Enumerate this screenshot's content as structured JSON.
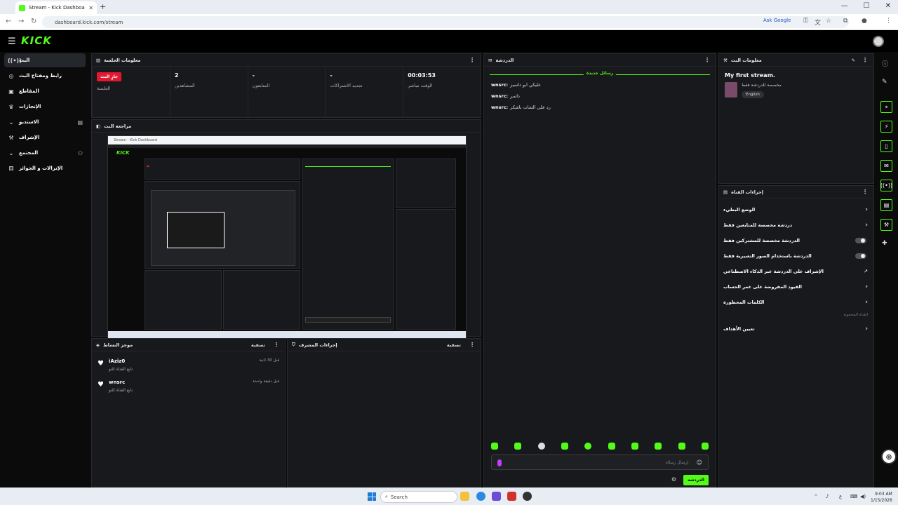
{
  "browser": {
    "tab_title": "Stream - Kick Dashboard",
    "url": "dashboard.kick.com/stream",
    "ask_google": "Ask Google"
  },
  "app": {
    "logo": "KICK"
  },
  "sidebar": {
    "items": [
      {
        "label": "البث",
        "icon": "broadcast-icon"
      },
      {
        "label": "رابط ومفتاح البث",
        "icon": "key-icon"
      },
      {
        "label": "المقاطع",
        "icon": "clips-icon"
      },
      {
        "label": "الإنجازات",
        "icon": "trophy-icon"
      },
      {
        "label": "الاستديو",
        "icon": "studio-icon"
      },
      {
        "label": "الإشراف",
        "icon": "mod-icon"
      },
      {
        "label": "المجتمع",
        "icon": "community-icon"
      },
      {
        "label": "الإنزالات و الجوائز",
        "icon": "drops-icon"
      }
    ]
  },
  "session": {
    "title": "معلومات الجلسة",
    "cells": [
      {
        "value": "00:03:53",
        "label": "الوقت مباشر"
      },
      {
        "value": "-",
        "label": "تجديد الاشتراكات"
      },
      {
        "value": "-",
        "label": "المتابعون"
      },
      {
        "value": "2",
        "label": "المشاهدين"
      },
      {
        "value": "جارٍ البث",
        "label": "الجلسة",
        "badge": true
      }
    ]
  },
  "preview": {
    "title": "مراجعة البث",
    "mini_title": "Stream - Kick Dashboard"
  },
  "activity": {
    "title": "موجز النشاط",
    "filter": "تصفية",
    "items": [
      {
        "name": "iAziz0",
        "sub": "تابع القناة للتو",
        "time": "قبل 30 ثانية"
      },
      {
        "name": "wnsrc",
        "sub": "تابع القناة للتو",
        "time": "قبل دقيقة واحدة"
      }
    ]
  },
  "modactions": {
    "title": "إجراءات المشرف",
    "filter": "تصفية"
  },
  "chat": {
    "title": "الدردشة",
    "new_messages": "رسائل جديدة",
    "messages": [
      {
        "user": "wnsrc:",
        "text": "عليكي ابو داسيز"
      },
      {
        "user": "wnsrc:",
        "text": "داسر"
      },
      {
        "user": "wnsrc:",
        "text": "رد على الشات باشكر"
      }
    ],
    "placeholder": "إرسال رسالة",
    "send": "الدردشة"
  },
  "stream_info": {
    "title": "معلومات البث",
    "stream_title": "My first stream.",
    "category": "مخصصة للدردشة فقط",
    "language": "English"
  },
  "channel_actions": {
    "title": "إجراءات القناة",
    "items": [
      {
        "label": "الوضع البطيء",
        "control": "arrow"
      },
      {
        "label": "دردشة مخصصة للمتابعين فقط",
        "control": "arrow"
      },
      {
        "label": "الدردشة مخصصة للمشتركين فقط",
        "control": "toggle"
      },
      {
        "label": "الدردشة باستخدام الصور التعبيرية فقط",
        "control": "toggle"
      },
      {
        "label": "الإشراف على الدردشة عبر الذكاء الاصطناعي",
        "control": "link"
      },
      {
        "label": "القيود المفروضة على عمر الحساب",
        "control": "arrow"
      },
      {
        "label": "الكلمات المحظورة",
        "control": "arrow"
      }
    ],
    "note": "القناة المحجوبة",
    "goals": "تعيين الأهداف"
  },
  "taskbar": {
    "search": "Search",
    "time": "9:03 AM",
    "date": "1/15/2026"
  },
  "colors": {
    "accent": "#53fc18",
    "live": "#e1182f",
    "panel": "#18191c"
  }
}
